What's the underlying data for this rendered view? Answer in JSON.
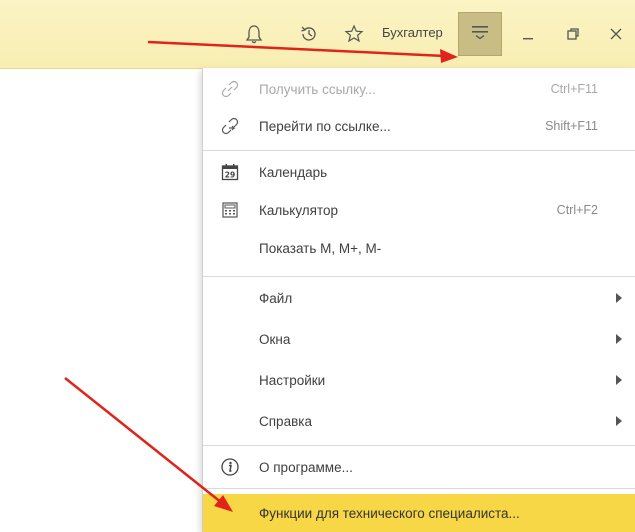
{
  "titlebar": {
    "user_label": "Бухгалтер",
    "icons": [
      "bell-icon",
      "history-icon",
      "star-icon",
      "hamburger-menu-icon",
      "minimize-icon",
      "restore-icon",
      "close-icon"
    ],
    "accent": "#f8eeb2",
    "menu_button_bg": "#c9bd86"
  },
  "menu": {
    "items": [
      {
        "label": "Получить ссылку...",
        "shortcut": "Ctrl+F11",
        "icon": "link-icon",
        "disabled": true
      },
      {
        "label": "Перейти по ссылке...",
        "shortcut": "Shift+F11",
        "icon": "go-to-link-icon"
      },
      {
        "label": "Календарь",
        "icon": "calendar-icon",
        "icon_text": "29"
      },
      {
        "label": "Калькулятор",
        "shortcut": "Ctrl+F2",
        "icon": "calculator-icon"
      },
      {
        "label": "Показать М, М+, М-"
      },
      {
        "label": "Файл",
        "submenu": true
      },
      {
        "label": "Окна",
        "submenu": true
      },
      {
        "label": "Настройки",
        "submenu": true
      },
      {
        "label": "Справка",
        "submenu": true
      },
      {
        "label": "О программе...",
        "icon": "info-icon"
      },
      {
        "label": "Функции для технического специалиста...",
        "highlighted": true
      }
    ],
    "highlight_color": "#f7d745"
  },
  "annotations": {
    "arrow_color": "#e0241b"
  }
}
